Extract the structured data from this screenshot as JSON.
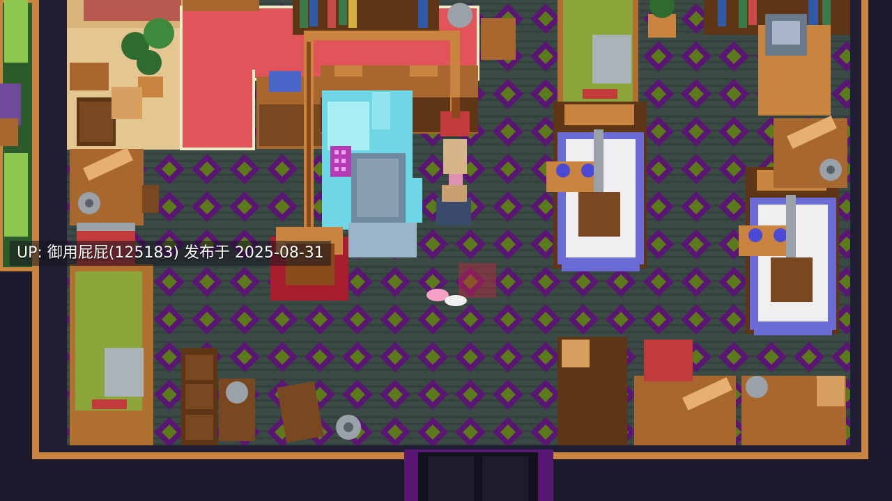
{
  "overlay": {
    "caption": "UP: 御用屁屁(125183) 发布于 2025-08-31"
  },
  "palette": {
    "background": "#1c1b2e",
    "floor_base": "#3b4a45",
    "floor_diamond": "#5a1673",
    "floor_dot": "#5c7a1a",
    "wall_trim": "#c9853f",
    "rug": "#e0545a",
    "wood": "#a8672e",
    "wood_dark": "#5e3616",
    "machine_blue": "#6fd6e6",
    "press_frame": "#6b6bd6",
    "green_machine": "#8ca53a",
    "toolbox_red": "#c23b3b",
    "metal": "#9aa1a8"
  }
}
